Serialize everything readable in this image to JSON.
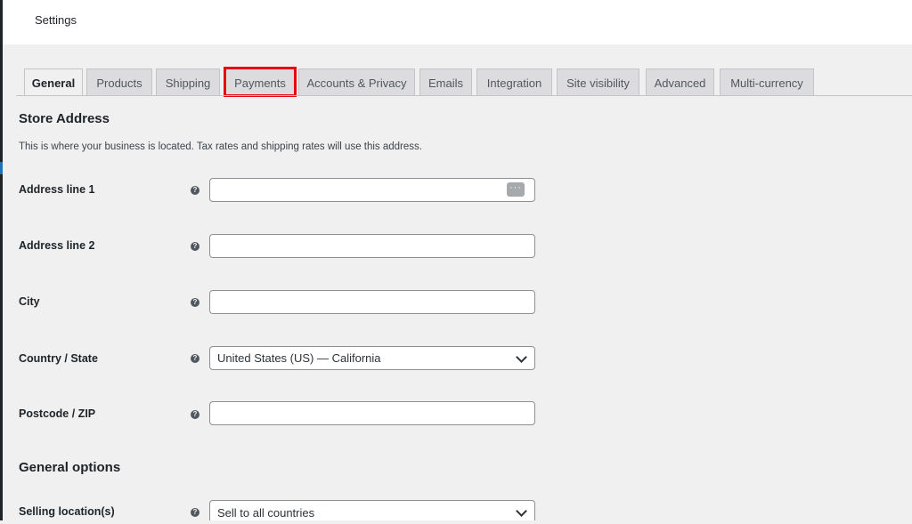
{
  "topbar": {
    "title": "Settings"
  },
  "tabs": [
    {
      "label": "General",
      "active": true
    },
    {
      "label": "Products"
    },
    {
      "label": "Shipping"
    },
    {
      "label": "Payments",
      "highlighted": true
    },
    {
      "label": "Accounts & Privacy"
    },
    {
      "label": "Emails"
    },
    {
      "label": "Integration"
    },
    {
      "label": "Site visibility"
    },
    {
      "label": "Advanced"
    },
    {
      "label": "Multi-currency"
    }
  ],
  "store_address": {
    "title": "Store Address",
    "description": "This is where your business is located. Tax rates and shipping rates will use this address.",
    "fields": {
      "address_line_1": {
        "label": "Address line 1",
        "value": ""
      },
      "address_line_2": {
        "label": "Address line 2",
        "value": ""
      },
      "city": {
        "label": "City",
        "value": ""
      },
      "country_state": {
        "label": "Country / State",
        "value": "United States (US) — California"
      },
      "postcode": {
        "label": "Postcode / ZIP",
        "value": ""
      }
    }
  },
  "general_options": {
    "title": "General options",
    "selling_location": {
      "label": "Selling location(s)",
      "value": "Sell to all countries"
    }
  },
  "help_glyph": "?",
  "autofill_glyph": "···",
  "colors": {
    "highlight": "#e5070f",
    "tab_bg": "#dcdcde",
    "page_bg": "#f0f0f1"
  }
}
